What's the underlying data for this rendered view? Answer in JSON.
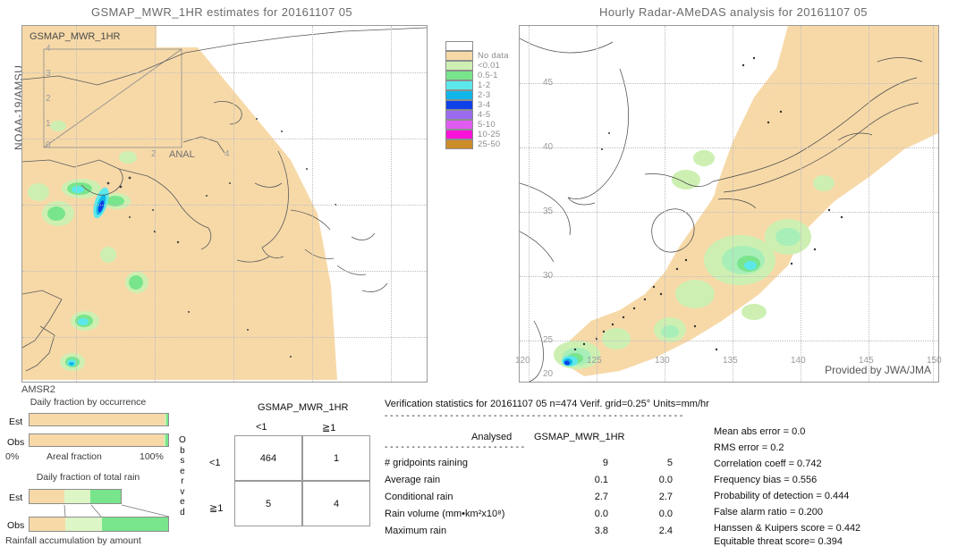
{
  "left_panel": {
    "title": "GSMAP_MWR_1HR estimates for 20161107 05",
    "side_label": "NOAA-19/AMSU",
    "bottom_label": "AMSR2",
    "inbox_label": "GSMAP_MWR_1HR",
    "anal_label": "ANAL",
    "inset_ticks": [
      "4",
      "3",
      "2",
      "1",
      "0"
    ],
    "inset_bottom_ticks": [
      "2",
      "4"
    ]
  },
  "right_panel": {
    "title": "Hourly Radar-AMeDAS analysis for 20161107 05",
    "credit": "Provided by JWA/JMA",
    "lat_ticks": [
      "45",
      "40",
      "35",
      "30",
      "25",
      "20"
    ],
    "lon_ticks": [
      "120",
      "125",
      "130",
      "135",
      "140",
      "145",
      "150"
    ]
  },
  "colorbar": {
    "entries": [
      {
        "label": "",
        "color": "#ffffff"
      },
      {
        "label": "No data",
        "color": "#f7d9a8"
      },
      {
        "label": "<0.01",
        "color": "#cdf0b2"
      },
      {
        "label": "0.5-1",
        "color": "#78e58c"
      },
      {
        "label": "1-2",
        "color": "#5ce8ea"
      },
      {
        "label": "2-3",
        "color": "#11b6e8"
      },
      {
        "label": "3-4",
        "color": "#1040e8"
      },
      {
        "label": "4-5",
        "color": "#9b6bf0"
      },
      {
        "label": "5-10",
        "color": "#e05cf0"
      },
      {
        "label": "10-25",
        "color": "#fa12d8"
      },
      {
        "label": "25-50",
        "color": "#cc8c2a"
      }
    ]
  },
  "occurrence_chart": {
    "title": "Daily fraction by occurrence",
    "axis_label": "Areal fraction",
    "axis_min": "0%",
    "axis_max": "100%",
    "rows": [
      {
        "label": "Est",
        "segments": [
          {
            "color": "#f7d9a8",
            "pct": 97.5
          },
          {
            "color": "#cdf0b2",
            "pct": 1.2
          },
          {
            "color": "#78e58c",
            "pct": 1.3
          }
        ]
      },
      {
        "label": "Obs",
        "segments": [
          {
            "color": "#f7d9a8",
            "pct": 97.0
          },
          {
            "color": "#cdf0b2",
            "pct": 1.3
          },
          {
            "color": "#78e58c",
            "pct": 1.7
          }
        ]
      }
    ]
  },
  "totalrain_chart": {
    "title": "Daily fraction of total rain",
    "axis_label": "Rainfall accumulation by amount",
    "rows": [
      {
        "label": "Est",
        "width_pct": 66,
        "segments": [
          {
            "color": "#f7d9a8",
            "pct": 38
          },
          {
            "color": "#ddf6c6",
            "pct": 29
          },
          {
            "color": "#78e58c",
            "pct": 33
          }
        ]
      },
      {
        "label": "Obs",
        "width_pct": 100,
        "segments": [
          {
            "color": "#f7d9a8",
            "pct": 26
          },
          {
            "color": "#ddf6c6",
            "pct": 26
          },
          {
            "color": "#78e58c",
            "pct": 48
          }
        ]
      }
    ]
  },
  "contingency": {
    "col_group_title": "GSMAP_MWR_1HR",
    "col_headers": [
      "<1",
      "≧1"
    ],
    "row_headers": [
      "<1",
      "≧1"
    ],
    "row_axis_label": "Observed",
    "cells": [
      [
        "464",
        "1"
      ],
      [
        "5",
        "4"
      ]
    ]
  },
  "verification": {
    "header": "Verification statistics for 20161107 05  n=474  Verif. grid=0.25°  Units=mm/hr",
    "divider": "- - - - - - - - - - - - - - - - - - - - - - - - - - - - - - - - - - - - - - - - - - - - - - - - - - - - - - -",
    "col_headers": [
      "Analysed",
      "GSMAP_MWR_1HR"
    ],
    "sub_divider": "- - - - - - - - - - - - - - - - - - - - - - - - - -",
    "rows": [
      {
        "name": "# gridpoints raining",
        "analysed": "9",
        "model": "5"
      },
      {
        "name": "Average rain",
        "analysed": "0.1",
        "model": "0.0"
      },
      {
        "name": "Conditional rain",
        "analysed": "2.7",
        "model": "2.7"
      },
      {
        "name": "Rain volume (mm•km²x10⁸)",
        "analysed": "0.0",
        "model": "0.0"
      },
      {
        "name": "Maximum rain",
        "analysed": "3.8",
        "model": "2.4"
      }
    ],
    "scores": [
      "Mean abs error = 0.0",
      "RMS error = 0.2",
      "Correlation coeff = 0.742",
      "Frequency bias = 0.556",
      "Probability of detection = 0.444",
      "False alarm ratio = 0.200",
      "Hanssen & Kuipers score = 0.442",
      "Equitable threat score= 0.394"
    ]
  }
}
